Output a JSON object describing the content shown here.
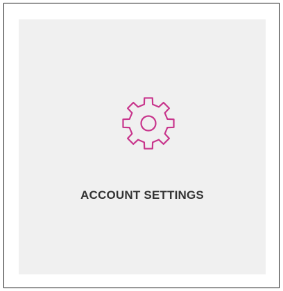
{
  "tile": {
    "label": "ACCOUNT SETTINGS",
    "icon": "gear-icon",
    "accent_color": "#c8358c",
    "background_color": "#f0f0f0",
    "text_color": "#333333"
  }
}
